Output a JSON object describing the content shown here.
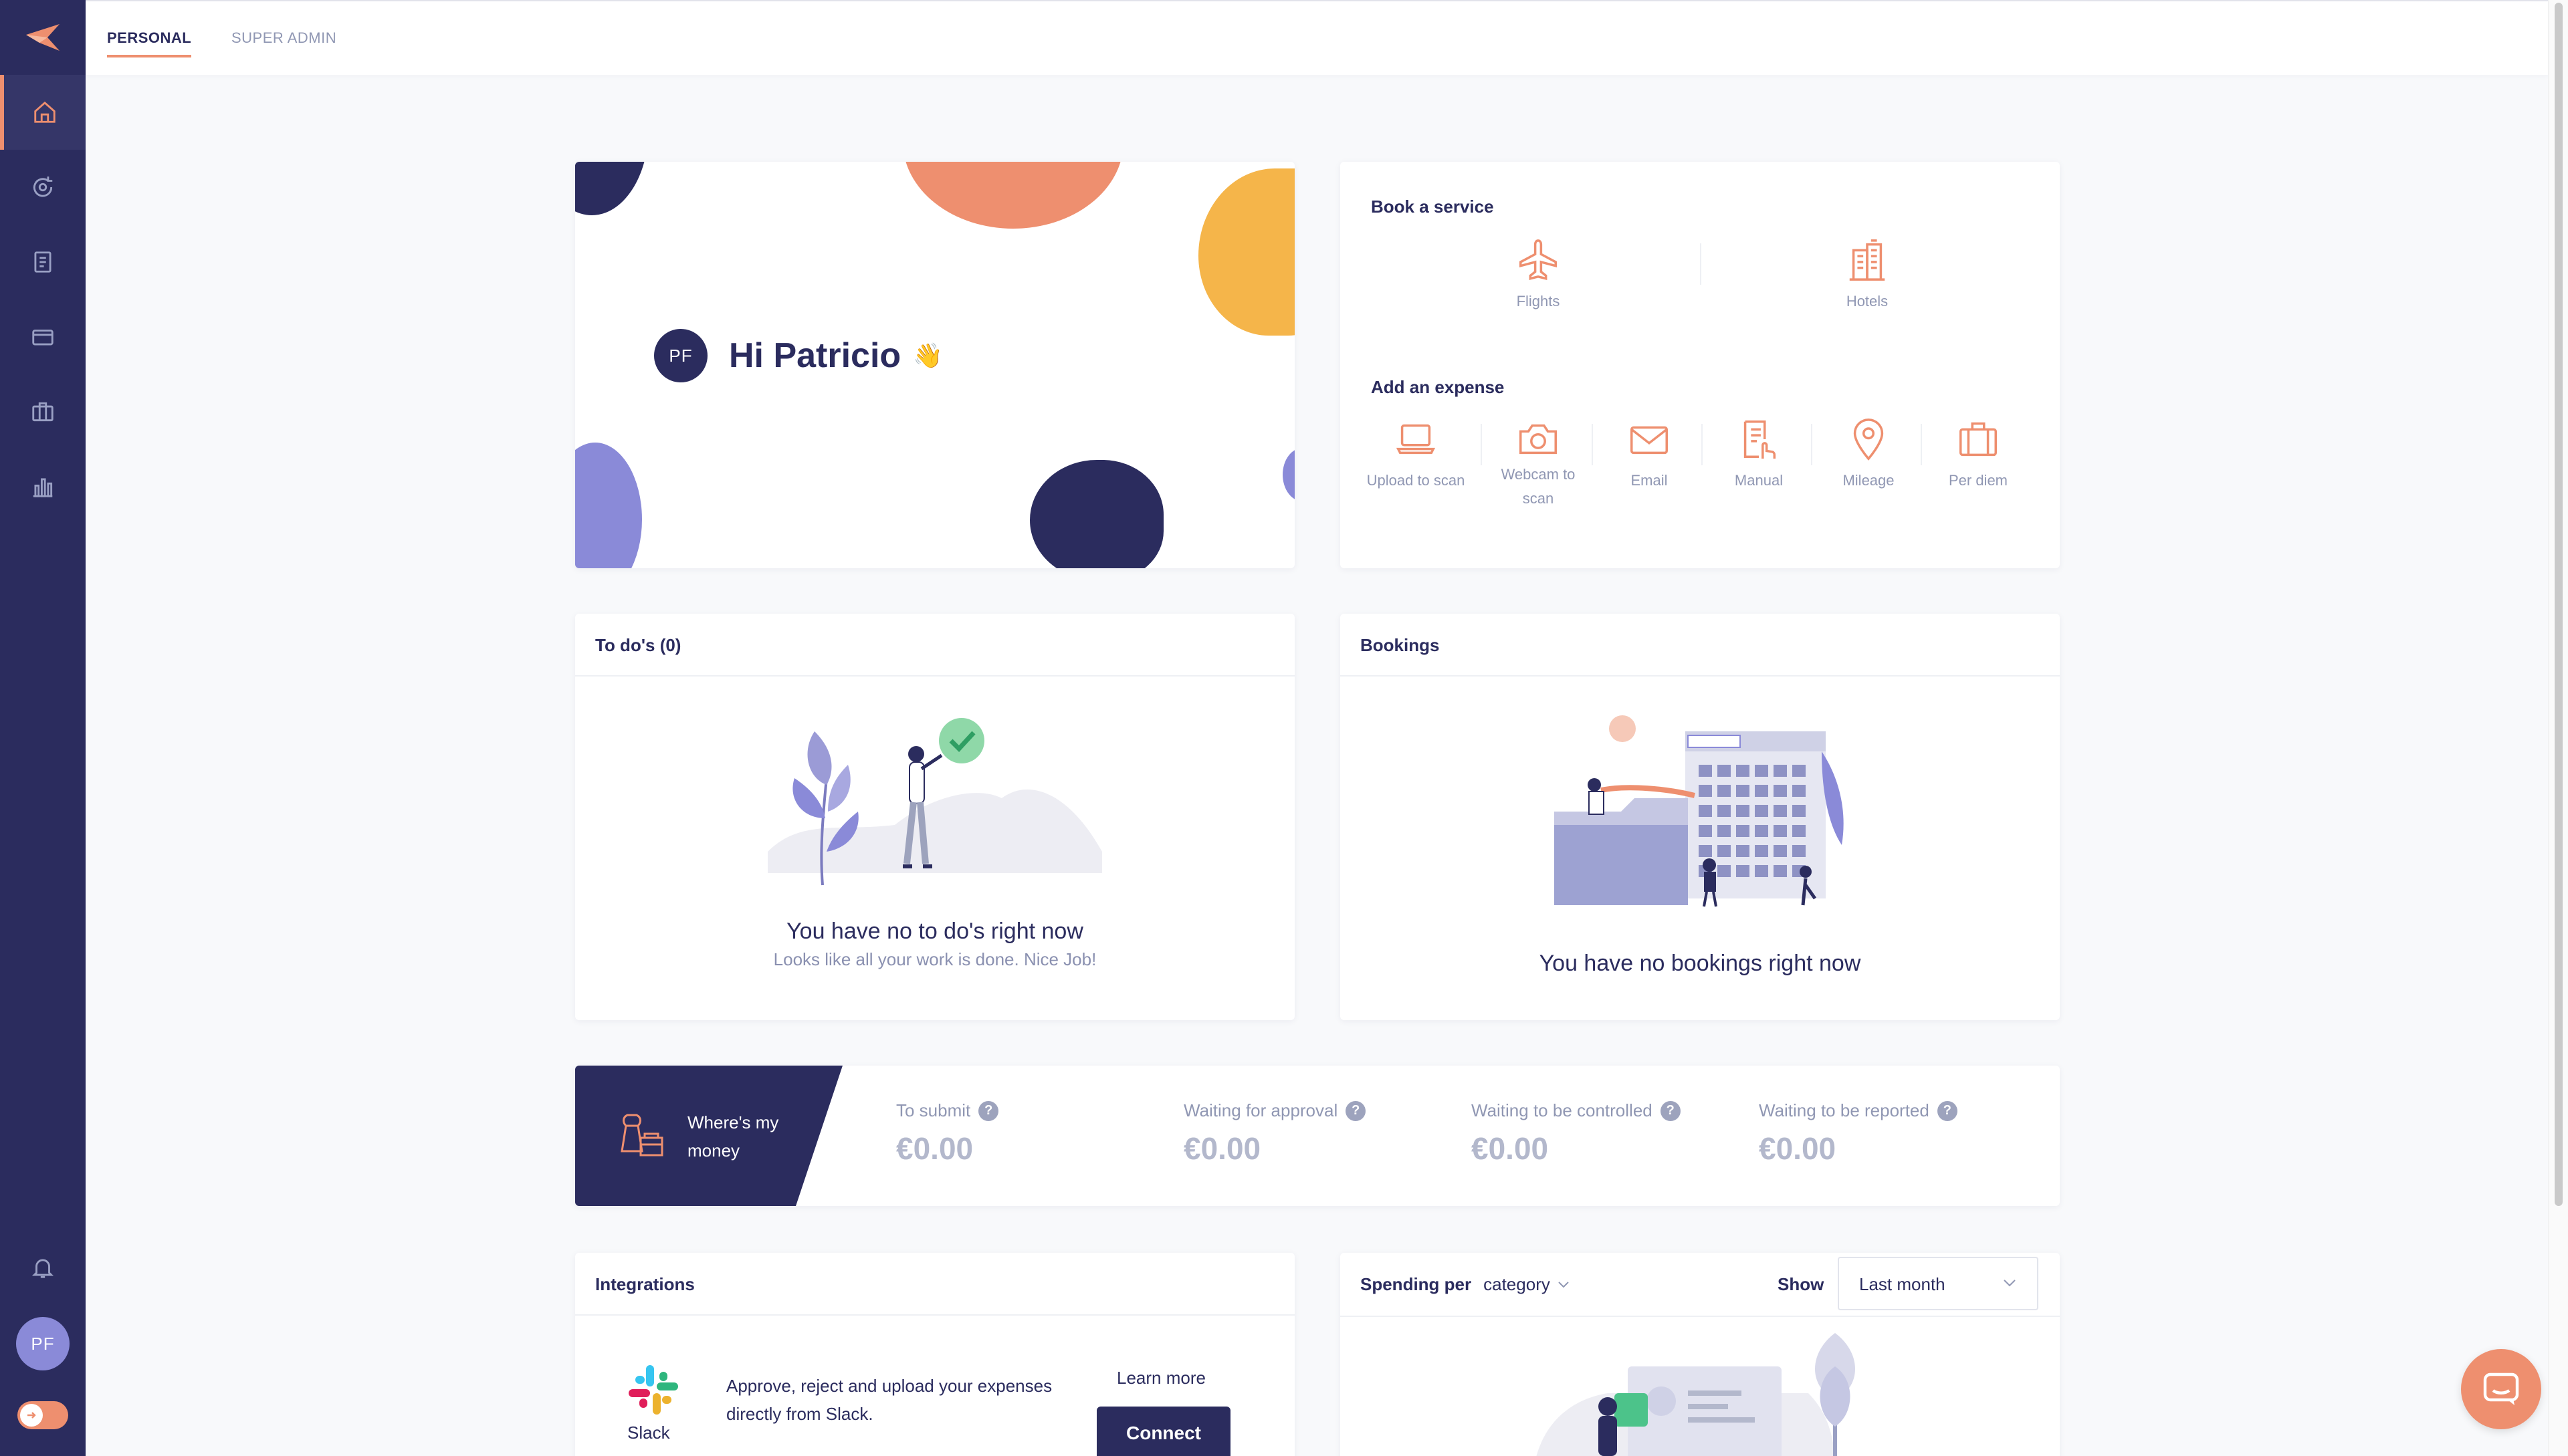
{
  "tabs": [
    {
      "label": "PERSONAL",
      "active": true
    },
    {
      "label": "SUPER ADMIN",
      "active": false
    }
  ],
  "sidebar": {
    "items": [
      {
        "icon": "home-icon",
        "active": true
      },
      {
        "icon": "refresh-icon",
        "active": false
      },
      {
        "icon": "document-icon",
        "active": false
      },
      {
        "icon": "card-icon",
        "active": false
      },
      {
        "icon": "briefcase-icon",
        "active": false
      },
      {
        "icon": "bar-chart-icon",
        "active": false
      }
    ],
    "avatar_initials": "PF"
  },
  "welcome": {
    "initials": "PF",
    "greeting": "Hi Patricio",
    "wave": "👋"
  },
  "services": {
    "book_title": "Book a service",
    "book": [
      {
        "label": "Flights",
        "icon": "plane-icon"
      },
      {
        "label": "Hotels",
        "icon": "hotel-icon"
      }
    ],
    "expense_title": "Add an expense",
    "expense": [
      {
        "label": "Upload to scan",
        "icon": "laptop-icon"
      },
      {
        "label": "Webcam to scan",
        "icon": "camera-icon"
      },
      {
        "label": "Email",
        "icon": "mail-icon"
      },
      {
        "label": "Manual",
        "icon": "manual-icon"
      },
      {
        "label": "Mileage",
        "icon": "map-pin-icon"
      },
      {
        "label": "Per diem",
        "icon": "suitcase-icon"
      }
    ]
  },
  "todos": {
    "title": "To do's (0)",
    "empty_title": "You have no to do's right now",
    "empty_sub": "Looks like all your work is done. Nice Job!"
  },
  "bookings": {
    "title": "Bookings",
    "empty_title": "You have no bookings right now"
  },
  "money": {
    "label_line1": "Where's my",
    "label_line2": "money",
    "stats": [
      {
        "label": "To submit",
        "value": "€0.00"
      },
      {
        "label": "Waiting for approval",
        "value": "€0.00"
      },
      {
        "label": "Waiting to be controlled",
        "value": "€0.00"
      },
      {
        "label": "Waiting to be reported",
        "value": "€0.00"
      }
    ],
    "help": "?"
  },
  "integrations": {
    "title": "Integrations",
    "app_name": "Slack",
    "description": "Approve, reject and upload your expenses directly from Slack.",
    "learn_more": "Learn more",
    "connect": "Connect"
  },
  "spending": {
    "title": "Spending per",
    "group_by": "category",
    "show_label": "Show",
    "period": "Last month"
  },
  "colors": {
    "sidebar": "#2b2c5e",
    "accent": "#ee8f6f",
    "yellow": "#f5b54a",
    "lavender": "#8a8ad8"
  }
}
